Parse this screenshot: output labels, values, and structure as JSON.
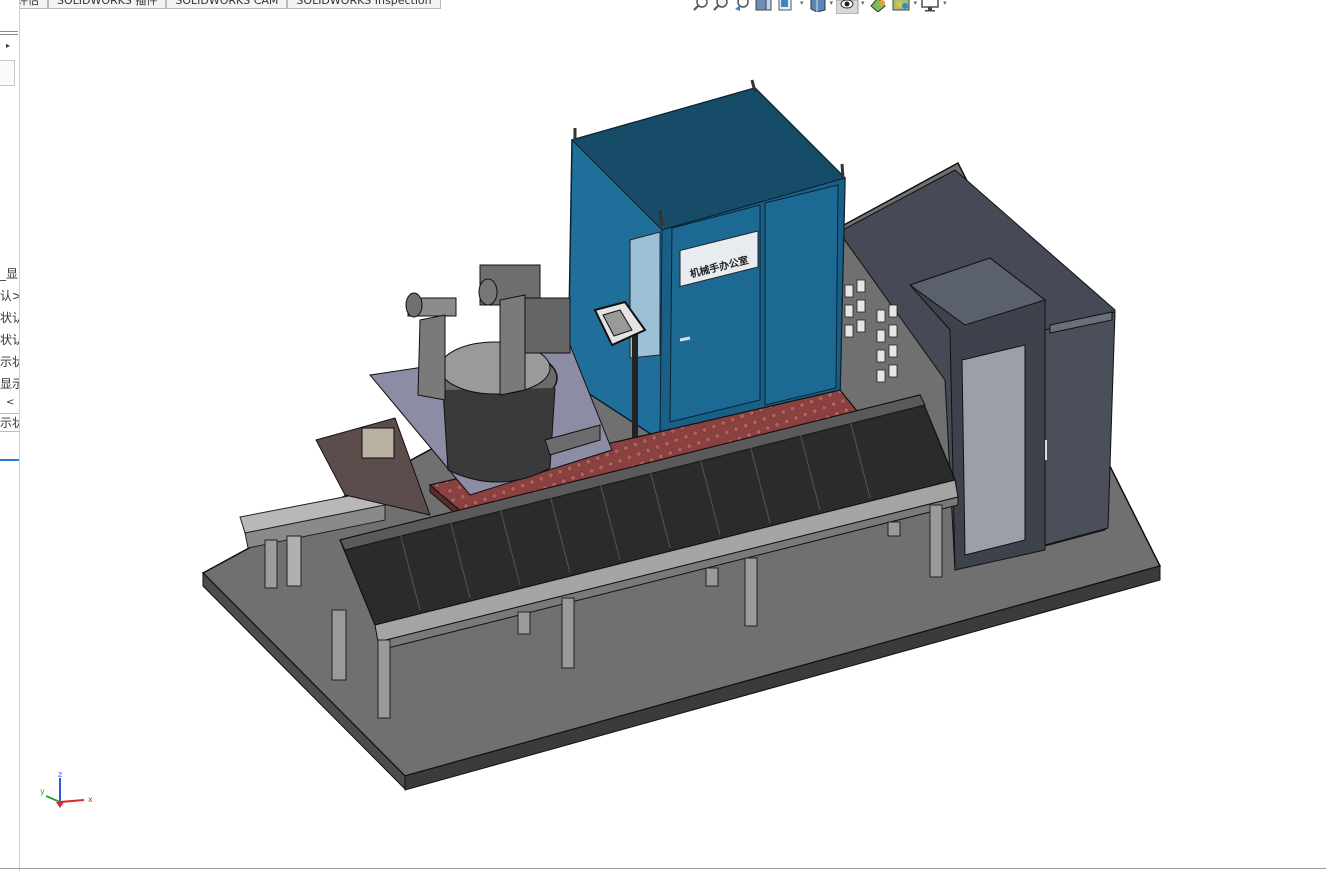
{
  "tabs": [
    {
      "label": "评估"
    },
    {
      "label": "SOLIDWORKS 插件"
    },
    {
      "label": "SOLIDWORKS CAM"
    },
    {
      "label": "SOLIDWORKS Inspection"
    }
  ],
  "feature_tree": {
    "items": [
      {
        "label": "_显"
      },
      {
        "label": "认>"
      },
      {
        "label": "状认"
      },
      {
        "label": "状认"
      },
      {
        "label": "示状"
      },
      {
        "label": "显示"
      },
      {
        "label": "<"
      },
      {
        "label": "示状"
      }
    ]
  },
  "heads_up_toolbar": {
    "icons": [
      {
        "name": "zoom-to-fit-icon"
      },
      {
        "name": "zoom-to-area-icon"
      },
      {
        "name": "previous-view-icon"
      },
      {
        "name": "section-view-icon"
      },
      {
        "name": "view-orientation-icon"
      },
      {
        "name": "display-style-icon"
      },
      {
        "name": "hide-show-items-icon"
      },
      {
        "name": "edit-appearance-icon"
      },
      {
        "name": "apply-scene-icon"
      },
      {
        "name": "view-settings-icon"
      }
    ]
  },
  "model": {
    "cabinet_nameplate": "机械手办公室"
  },
  "triad": {
    "x_label": "x",
    "y_label": "y",
    "z_label": "z"
  },
  "colors": {
    "cabinet_blue": "#1f6f9a",
    "platform_red": "#8a3f3f",
    "base_gray": "#6e6e6e",
    "accent": "#2b7bd0"
  }
}
